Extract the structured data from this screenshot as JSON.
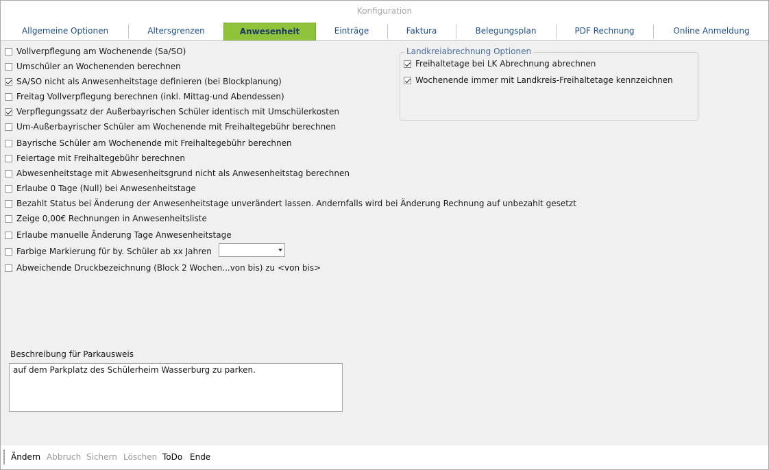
{
  "window": {
    "title": "Konfiguration"
  },
  "tabs": [
    {
      "label": "Allgemeine Optionen",
      "active": false
    },
    {
      "label": "Altersgrenzen",
      "active": false
    },
    {
      "label": "Anwesenheit",
      "active": true
    },
    {
      "label": "Einträge",
      "active": false
    },
    {
      "label": "Faktura",
      "active": false
    },
    {
      "label": "Belegungsplan",
      "active": false
    },
    {
      "label": "PDF Rechnung",
      "active": false
    },
    {
      "label": "Online Anmeldung",
      "active": false
    }
  ],
  "options": [
    {
      "label": "Vollverpflegung am Wochenende (Sa/SO)",
      "checked": false
    },
    {
      "label": "Umschüler an Wochenenden berechnen",
      "checked": false
    },
    {
      "label": "SA/SO nicht als Anwesenheitstage definieren (bei Blockplanung)",
      "checked": true
    },
    {
      "label": "Freitag Vollverpflegung berechnen (inkl. Mittag-und Abendessen)",
      "checked": false
    },
    {
      "label": "Verpflegungssatz der Außerbayrischen Schüler identisch mit Umschülerkosten",
      "checked": true
    },
    {
      "label": "Um-Außerbayrischer Schüler am Wochenende mit Freihaltegebühr berechnen",
      "checked": false
    },
    {
      "label": "Bayrische Schüler am Wochenende mit Freihaltegebühr berechnen",
      "checked": false
    },
    {
      "label": "Feiertage mit Freihaltegebühr berechnen",
      "checked": false
    },
    {
      "label": "Abwesenheitstage mit Abwesenheitsgrund nicht als Anwesenheitstag berechnen",
      "checked": false
    },
    {
      "label": "Erlaube 0 Tage (Null) bei Anwesenheitstage",
      "checked": false
    },
    {
      "label": "Bezahlt Status bei Änderung der Anwesenheitstage unverändert lassen. Andernfalls wird bei Änderung Rechnung auf unbezahlt gesetzt",
      "checked": false
    },
    {
      "label": "Zeige 0,00€ Rechnungen in Anwesenheitsliste",
      "checked": false
    },
    {
      "label": "Erlaube manuelle Änderung Tage Anwesenheitstage",
      "checked": false
    },
    {
      "label": "Farbige Markierung für by. Schüler ab xx Jahren",
      "checked": false
    },
    {
      "label": "Abweichende Druckbezeichnung (Block 2 Wochen...von bis) zu <von bis>",
      "checked": false
    }
  ],
  "age_select": {
    "value": ""
  },
  "landkreis": {
    "title": "Landkreiabrechnung Optionen",
    "options": [
      {
        "label": "Freihaltetage bei LK Abrechnung abrechnen",
        "checked": true
      },
      {
        "label": "Wochenende immer mit Landkreis-Freihaltetage kennzeichnen",
        "checked": true
      }
    ]
  },
  "parkausweis": {
    "label": "Beschreibung für Parkausweis",
    "value": "auf dem Parkplatz des Schülerheim Wasserburg zu parken."
  },
  "footer": {
    "aendern": "Ändern",
    "abbruch": "Abbruch",
    "sichern": "Sichern",
    "loeschen": "Löschen",
    "todo": "ToDo",
    "ende": "Ende"
  }
}
